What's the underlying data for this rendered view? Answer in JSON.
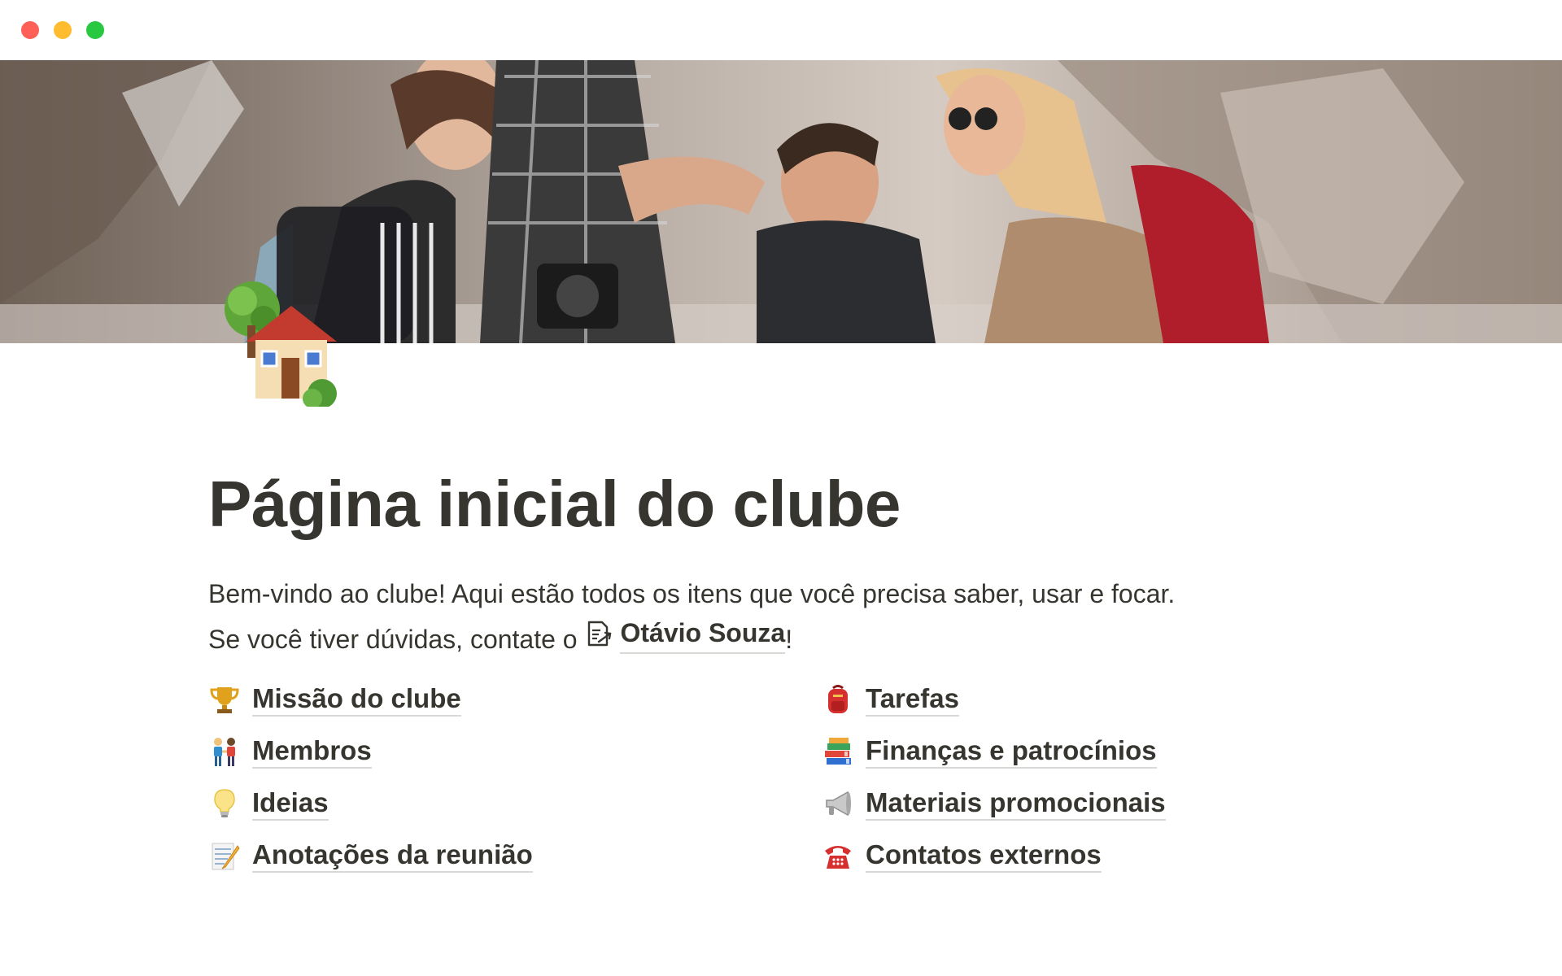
{
  "page": {
    "title": "Página inicial do clube",
    "intro_line1": "Bem-vindo ao clube! Aqui estão todos os itens que você precisa saber, usar e focar.",
    "intro_line2_prefix": "Se você tiver dúvidas, contate o",
    "contact_name": "Otávio Souza",
    "intro_line2_suffix": "!",
    "page_icon": "house-with-garden-icon"
  },
  "links_left": [
    {
      "label": "Missão do clube",
      "icon": "trophy-icon"
    },
    {
      "label": "Membros",
      "icon": "people-holding-hands-icon"
    },
    {
      "label": "Ideias",
      "icon": "light-bulb-icon"
    },
    {
      "label": "Anotações da reunião",
      "icon": "memo-icon"
    }
  ],
  "links_right": [
    {
      "label": "Tarefas",
      "icon": "backpack-icon"
    },
    {
      "label": "Finanças e patrocínios",
      "icon": "books-icon"
    },
    {
      "label": "Materiais promocionais",
      "icon": "megaphone-icon"
    },
    {
      "label": "Contatos externos",
      "icon": "telephone-icon"
    }
  ],
  "colors": {
    "text": "#37352f",
    "underline": "#d9d8d5",
    "traffic_close": "#fe5f57",
    "traffic_minimize": "#febc2e",
    "traffic_maximize": "#28c840"
  }
}
